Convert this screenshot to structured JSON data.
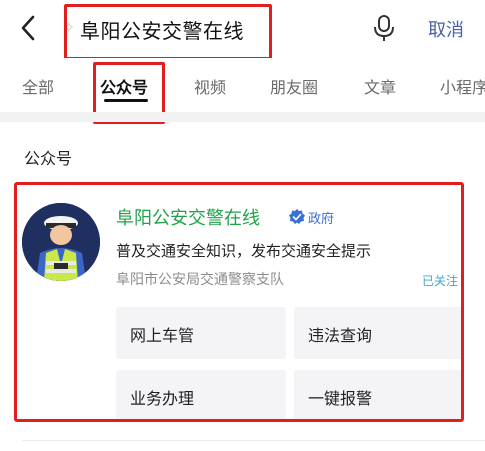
{
  "search": {
    "query": "阜阳公安交警在线",
    "cancel_label": "取消"
  },
  "tabs": [
    {
      "label": "全部",
      "active": false
    },
    {
      "label": "公众号",
      "active": true
    },
    {
      "label": "视频",
      "active": false
    },
    {
      "label": "朋友圈",
      "active": false
    },
    {
      "label": "文章",
      "active": false
    },
    {
      "label": "小程序",
      "active": false
    }
  ],
  "section": {
    "title": "公众号"
  },
  "result": {
    "name": "阜阳公安交警在线",
    "badge": "政府",
    "description": "普及交通安全知识，发布交通安全提示",
    "organization": "阜阳市公安局交通警察支队",
    "follow_status": "已关注",
    "menu": [
      {
        "label": "网上车管"
      },
      {
        "label": "违法查询"
      },
      {
        "label": "业务办理"
      },
      {
        "label": "一键报警"
      }
    ]
  },
  "colors": {
    "accent_green": "#21a24a",
    "link_blue": "#4b62a8",
    "annotation_red": "#e11d1d"
  }
}
